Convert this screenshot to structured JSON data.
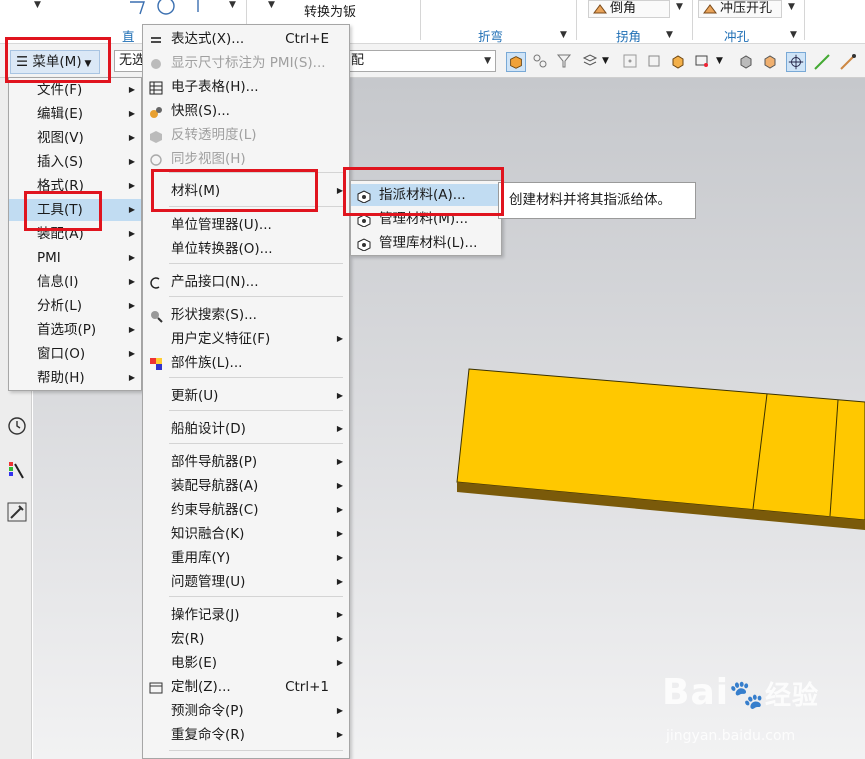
{
  "ribbon": {
    "top_labels": {
      "convert_sheet": "转换为钣",
      "chamfer": "倒角",
      "punch_hole": "冲压开孔"
    },
    "groups": {
      "straight": "直",
      "bend": "折弯",
      "corner": "拐角",
      "punch": "冲孔"
    }
  },
  "cmdbar": {
    "filter_value": "无选",
    "assembly_value": "配"
  },
  "menu_button": {
    "label": "菜单(M)"
  },
  "main_menu": [
    {
      "label": "文件(F)"
    },
    {
      "label": "编辑(E)"
    },
    {
      "label": "视图(V)"
    },
    {
      "label": "插入(S)"
    },
    {
      "label": "格式(R)"
    },
    {
      "label": "工具(T)"
    },
    {
      "label": "装配(A)"
    },
    {
      "label": "PMI"
    },
    {
      "label": "信息(I)"
    },
    {
      "label": "分析(L)"
    },
    {
      "label": "首选项(P)"
    },
    {
      "label": "窗口(O)"
    },
    {
      "label": "帮助(H)"
    }
  ],
  "tools_menu": [
    {
      "label": "表达式(X)...",
      "shortcut": "Ctrl+E"
    },
    {
      "label": "显示尺寸标注为 PMI(S)..."
    },
    {
      "label": "电子表格(H)..."
    },
    {
      "label": "快照(S)..."
    },
    {
      "label": "反转透明度(L)"
    },
    {
      "label": "同步视图(H)"
    },
    {
      "label": "材料(M)"
    },
    {
      "label": "单位管理器(U)..."
    },
    {
      "label": "单位转换器(O)..."
    },
    {
      "label": "产品接口(N)..."
    },
    {
      "label": "形状搜索(S)..."
    },
    {
      "label": "用户定义特征(F)"
    },
    {
      "label": "部件族(L)..."
    },
    {
      "label": "更新(U)"
    },
    {
      "label": "船舶设计(D)"
    },
    {
      "label": "部件导航器(P)"
    },
    {
      "label": "装配导航器(A)"
    },
    {
      "label": "约束导航器(C)"
    },
    {
      "label": "知识融合(K)"
    },
    {
      "label": "重用库(Y)"
    },
    {
      "label": "问题管理(U)"
    },
    {
      "label": "操作记录(J)"
    },
    {
      "label": "宏(R)"
    },
    {
      "label": "电影(E)"
    },
    {
      "label": "定制(Z)...",
      "shortcut": "Ctrl+1"
    },
    {
      "label": "预测命令(P)"
    },
    {
      "label": "重复命令(R)"
    }
  ],
  "material_menu": [
    {
      "label": "指派材料(A)..."
    },
    {
      "label": "管理材料(M)..."
    },
    {
      "label": "管理库材料(L)..."
    }
  ],
  "tooltip": "创建材料并将其指派给体。",
  "watermark": {
    "brand": "Bai",
    "brand_cn": "经验",
    "url": "jingyan.baidu.com"
  },
  "colors": {
    "highlight": "#c1dcf2",
    "annotation": "#e0141e",
    "part_top": "#ffc800",
    "part_side": "#7a5a0a"
  }
}
